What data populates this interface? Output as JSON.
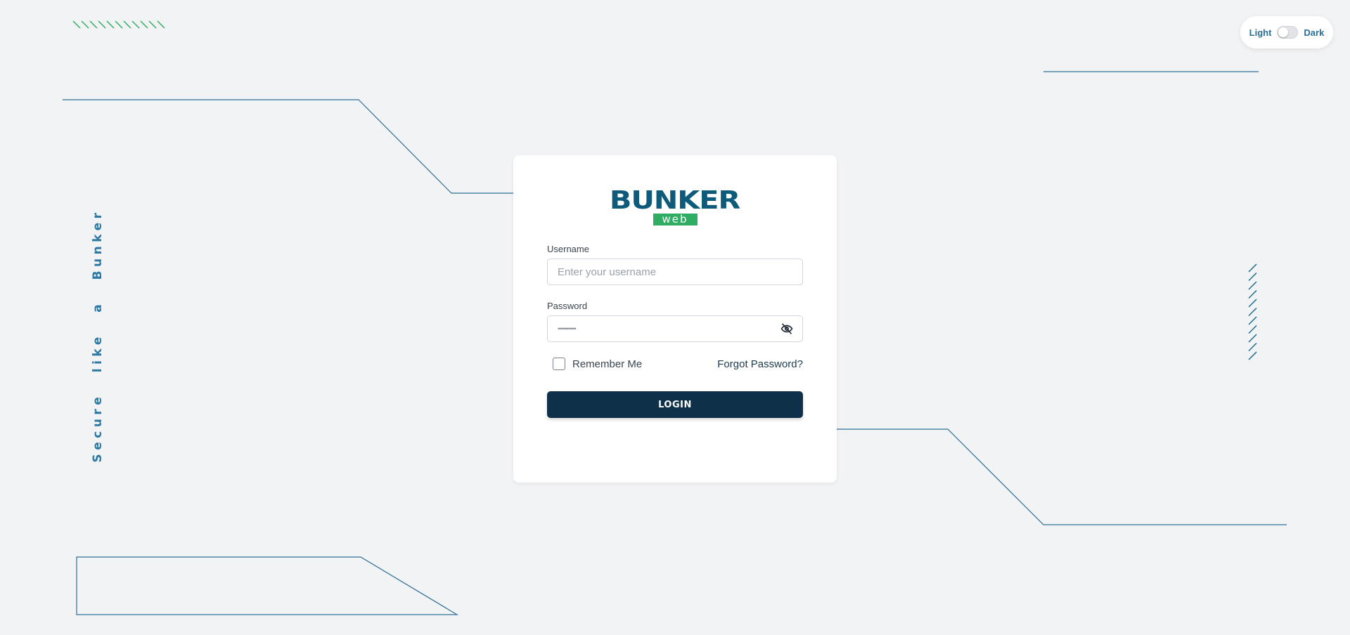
{
  "theme_toggle": {
    "light_label": "Light",
    "dark_label": "Dark",
    "state": "light"
  },
  "tagline": "Secure like a Bunker",
  "logo": {
    "word": "BUNKER",
    "sub": "web"
  },
  "colors": {
    "brand_primary": "#0e5a7b",
    "brand_green": "#2fae63",
    "button_bg": "#0e3149",
    "deco_line": "#2f6f95"
  },
  "form": {
    "username_label": "Username",
    "username_placeholder": "Enter your username",
    "username_value": "",
    "password_label": "Password",
    "password_value": "••••••••••••",
    "password_toggle_icon": "eye-off-icon",
    "remember_label": "Remember Me",
    "remember_checked": false,
    "forgot_label": "Forgot Password?",
    "login_label": "LOGIN"
  }
}
